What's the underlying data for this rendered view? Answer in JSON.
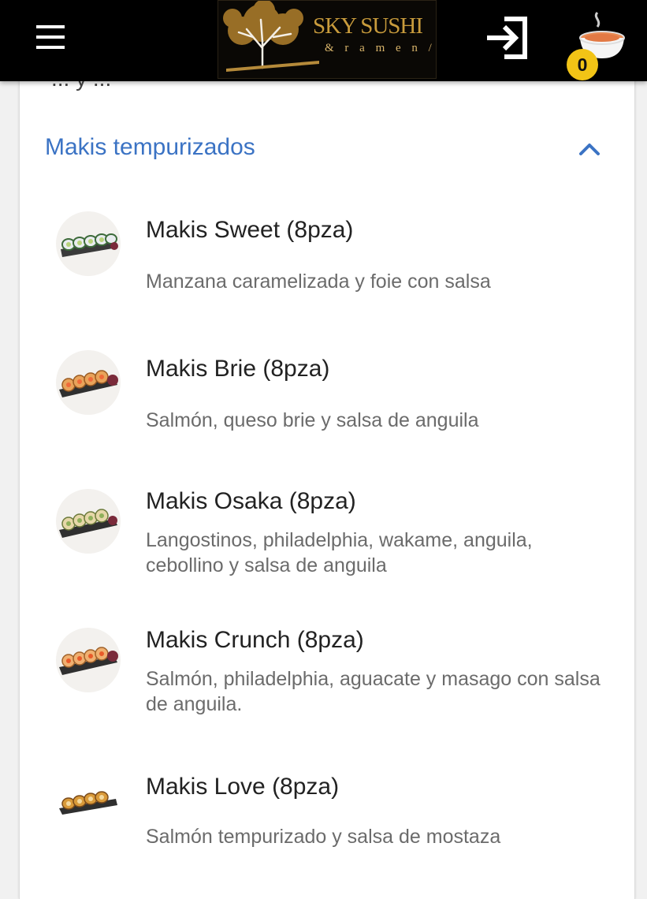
{
  "header": {
    "menu_icon": "hamburger-menu-icon",
    "logo": {
      "title": "SKY SUSHI",
      "subtitle": "& r a m e n / b a r"
    },
    "login_icon": "login-arrow-icon",
    "cart_icon": "ramen-bowl-icon",
    "cart_count": "0",
    "colors": {
      "bar": "#000000",
      "logo_gold": "#c89b3c",
      "badge": "#f2c416"
    }
  },
  "previous_section_fragment": "... y ... ",
  "section": {
    "title": "Makis tempurizados",
    "chevron_icon": "chevron-up-icon",
    "accent_color": "#3b73c4",
    "items": [
      {
        "name": "Makis Sweet (8pza)",
        "description": "Manzana caramelizada y foie con salsa",
        "image_icon": "maki-sweet-photo"
      },
      {
        "name": "Makis Brie (8pza)",
        "description": "Salmón, queso brie y salsa de anguila",
        "image_icon": "maki-brie-photo"
      },
      {
        "name": "Makis Osaka (8pza)",
        "description": "Langostinos, philadelphia, wakame, anguila, cebollino y salsa de anguila",
        "image_icon": "maki-osaka-photo"
      },
      {
        "name": "Makis Crunch (8pza)",
        "description": "Salmón, philadelphia, aguacate y masago con salsa de anguila.",
        "image_icon": "maki-crunch-photo"
      },
      {
        "name": "Makis Love (8pza)",
        "description": "Salmón tempurizado y salsa de mostaza",
        "image_icon": "maki-love-photo"
      }
    ]
  }
}
